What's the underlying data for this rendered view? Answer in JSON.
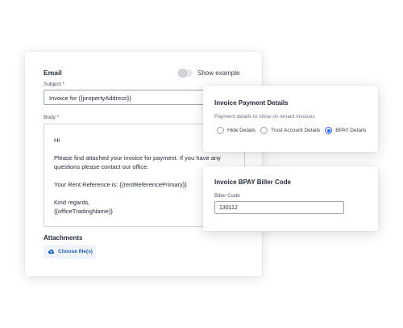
{
  "email": {
    "title": "Email",
    "show_example_label": "Show example",
    "subject_label": "Subject",
    "subject_required": "*",
    "subject_value": "Invoice for {{propertyAddress}}",
    "body_label": "Body",
    "body_required": "*",
    "body_lines": {
      "l1": "Hi",
      "l2": "Please find attached your invoice for payment. If you have any",
      "l3": "questions please contact our office.",
      "l4": "Your Rent Reference is: {{rentReferencePrimary}}",
      "l5": "Kind regards,",
      "l6": "{{officeTradingName}}"
    },
    "attachments_title": "Attachments",
    "choose_files_label": "Choose file(s)"
  },
  "payment": {
    "title": "Invoice Payment Details",
    "subtitle": "Payment details to show on tenant invoices",
    "options": [
      "Hide Details",
      "Trust Account Details",
      "BPAY Details"
    ],
    "selected": "BPAY Details"
  },
  "bpay": {
    "title": "Invoice BPAY Biller Code",
    "biller_label": "Biller Code",
    "biller_value": "130112"
  },
  "colors": {
    "accent": "#2563eb",
    "button_bg": "#eef4fa",
    "button_text": "#2563b0"
  }
}
